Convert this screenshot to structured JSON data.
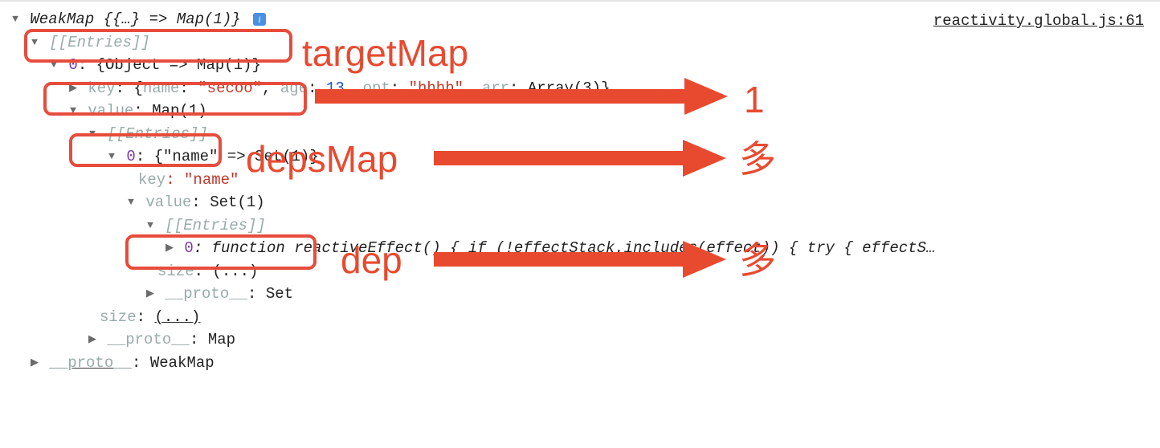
{
  "source_link": "reactivity.global.js:61",
  "root_label": "WeakMap {{…} => Map(1)}",
  "entries_label": "[[Entries]]",
  "entry0_index": "0",
  "entry0_summary": ": {Object => Map(1)}",
  "entry0_key_label": "key",
  "entry0_key_open": ": {",
  "entry0_key_name_k": "name",
  "entry0_key_name_v": "\"secoo\"",
  "entry0_key_age_k": "age",
  "entry0_key_age_v": "13",
  "entry0_key_opt_k": "opt",
  "entry0_key_opt_v": "\"hhhh\"",
  "entry0_key_arr_k": "arr",
  "entry0_key_arr_v": "Array(3)",
  "entry0_key_close": "}",
  "entry0_value_label": "value",
  "entry0_value_summary": ": Map(1)",
  "inner_entries_label": "[[Entries]]",
  "inner0_index": "0",
  "inner0_summary": ": {\"name\" => Set(1)}",
  "inner0_key_label": "key",
  "inner0_key_value": ": \"name\"",
  "inner0_value_label": "value",
  "inner0_value_summary": ": Set(1)",
  "set_entries_label": "[[Entries]]",
  "set0_index": "0",
  "set0_summary": ": function reactiveEffect() { if (!effectStack.includes(effect)) { try { effectS…",
  "set_size_label": "size",
  "set_size_value": ": (...)",
  "set_proto_label": "__proto__",
  "set_proto_value": ": Set",
  "map_size_label": "size",
  "map_size_value": ": ",
  "map_size_paren": "(...)",
  "map_proto_label": "__proto__",
  "map_proto_value": ": Map",
  "root_proto_label": "__proto__",
  "root_proto_value": ": WeakMap",
  "annotations": {
    "targetMap": "targetMap",
    "depsMap": "depsMap",
    "dep": "dep",
    "one": "1",
    "many1": "多",
    "many2": "多"
  }
}
